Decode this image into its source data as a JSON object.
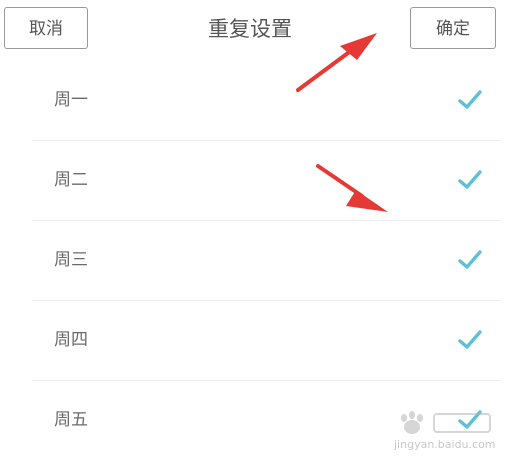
{
  "header": {
    "cancel_label": "取消",
    "title": "重复设置",
    "confirm_label": "确定"
  },
  "days": [
    {
      "label": "周一",
      "checked": true
    },
    {
      "label": "周二",
      "checked": true
    },
    {
      "label": "周三",
      "checked": true
    },
    {
      "label": "周四",
      "checked": true
    },
    {
      "label": "周五",
      "checked": true
    }
  ],
  "colors": {
    "check": "#5ec1d1",
    "arrow": "#e53935",
    "divider": "#eeeeee",
    "text": "#6a6a6a"
  },
  "watermark": {
    "icon": "baidu-jingyan-logo",
    "url_text": "jingyan.baidu.com"
  }
}
